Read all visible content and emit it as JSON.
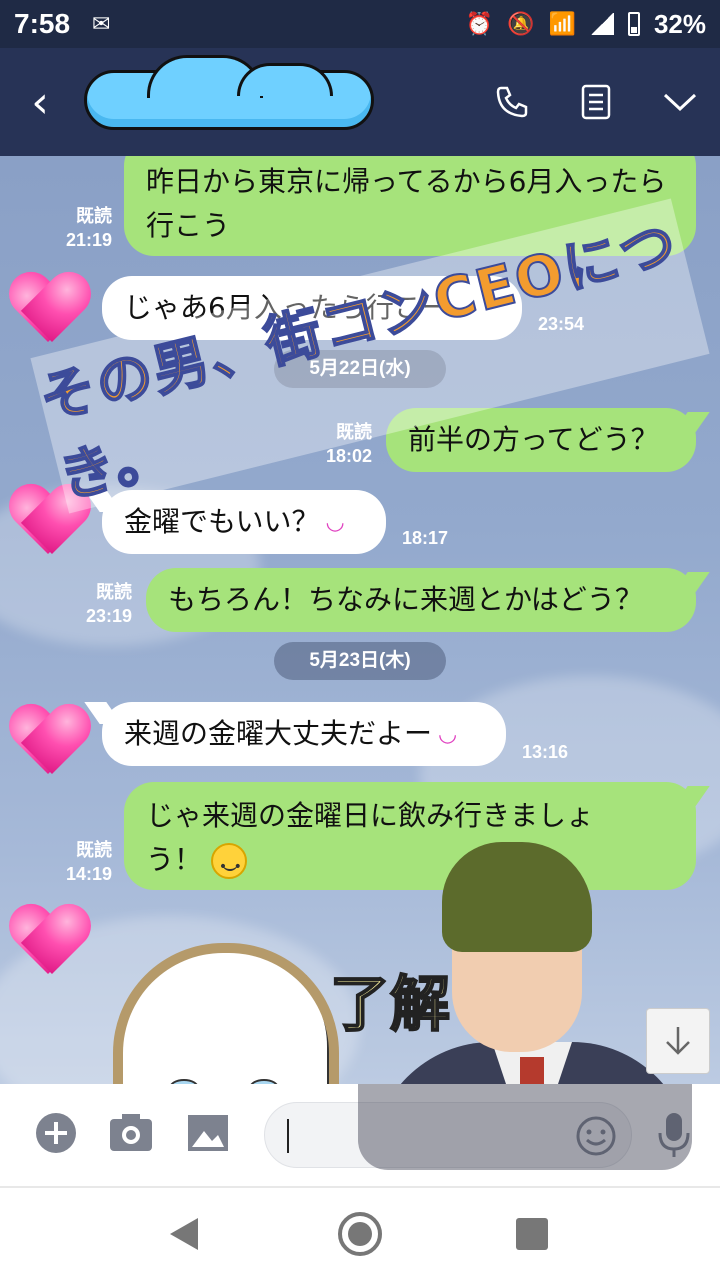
{
  "status_bar": {
    "time": "7:58",
    "battery": "32%"
  },
  "header": {
    "title_partial": "ゆ"
  },
  "watermark": {
    "text": "その男、街コンCEOにつき。"
  },
  "messages": [
    {
      "side": "right",
      "text": "昨日から東京に帰ってるから6月入ったら行こう",
      "read": "既読",
      "time": "21:19"
    },
    {
      "side": "left",
      "text": "じゃあ6月入ったら行こー",
      "time": "23:54"
    },
    {
      "side": "date",
      "text": "5月22日(水)"
    },
    {
      "side": "right",
      "text": "前半の方ってどう？",
      "read": "既読",
      "time": "18:02"
    },
    {
      "side": "left",
      "text": "金曜でもいい？",
      "time": "18:17"
    },
    {
      "side": "right",
      "text": "もちろん！ちなみに来週とかはどう？",
      "read": "既読",
      "time": "23:19"
    },
    {
      "side": "date",
      "text": "5月23日(木)"
    },
    {
      "side": "left",
      "text": "来週の金曜大丈夫だよー",
      "time": "13:16"
    },
    {
      "side": "right",
      "text_line1": "じゃ来週の金曜日に飲み行きましょ",
      "text_line2": "う！",
      "read": "既読",
      "time": "14:19"
    }
  ],
  "sticker": {
    "text": "了解"
  },
  "colors": {
    "header_bg": "#273356",
    "status_bg": "#1f2a45",
    "bubble_green": "#a6e37b",
    "bubble_white": "#ffffff",
    "chat_bg": "#93a9cd"
  }
}
